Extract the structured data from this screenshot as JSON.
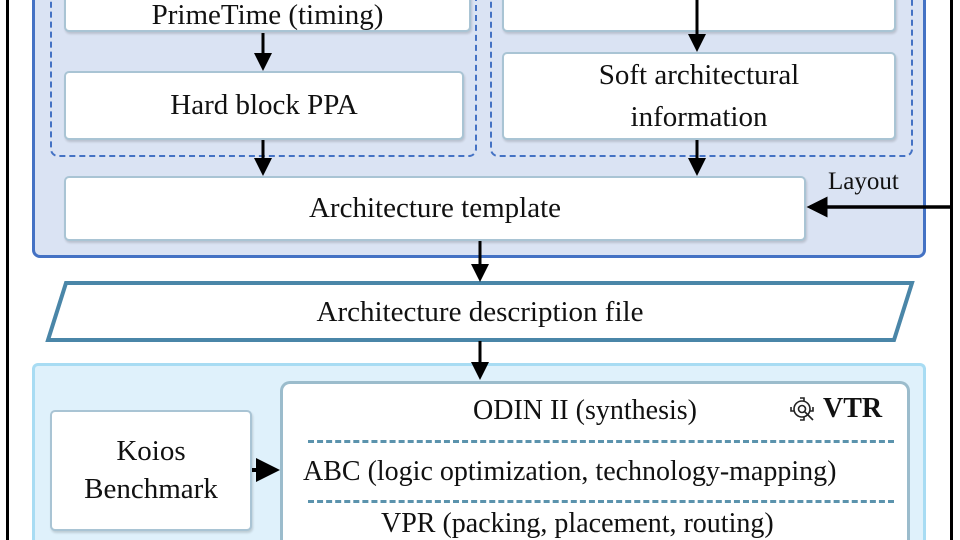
{
  "diagram": {
    "top_left_box": "PrimeTime (timing)",
    "hard_block": "Hard block PPA",
    "soft_info": "Soft architectural information",
    "template": "Architecture template",
    "layout_label": "Layout",
    "description_file": "Architecture description file",
    "benchmark": "Koios Benchmark",
    "vtr_label": "VTR",
    "vtr_icon": "gear-wrench-icon",
    "stages": [
      "ODIN II (synthesis)",
      "ABC (logic optimization, technology-mapping)",
      "VPR (packing, placement, routing)"
    ]
  },
  "colors": {
    "blue_container": "#dae3f3",
    "blue_border": "#4472c4",
    "light_container": "#dff1fb",
    "teal_border": "#4a86a8"
  }
}
